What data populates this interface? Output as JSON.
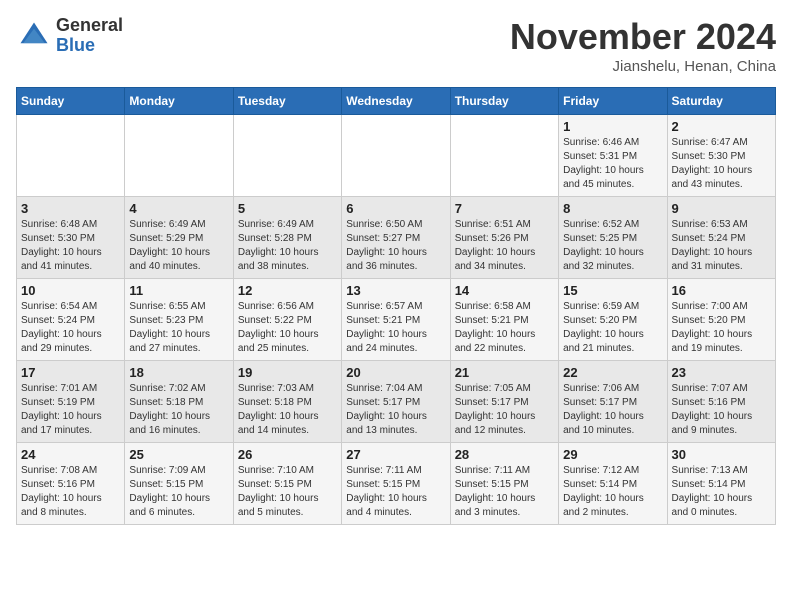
{
  "header": {
    "logo_general": "General",
    "logo_blue": "Blue",
    "month": "November 2024",
    "location": "Jianshelu, Henan, China"
  },
  "weekdays": [
    "Sunday",
    "Monday",
    "Tuesday",
    "Wednesday",
    "Thursday",
    "Friday",
    "Saturday"
  ],
  "weeks": [
    [
      {
        "day": "",
        "info": ""
      },
      {
        "day": "",
        "info": ""
      },
      {
        "day": "",
        "info": ""
      },
      {
        "day": "",
        "info": ""
      },
      {
        "day": "",
        "info": ""
      },
      {
        "day": "1",
        "info": "Sunrise: 6:46 AM\nSunset: 5:31 PM\nDaylight: 10 hours\nand 45 minutes."
      },
      {
        "day": "2",
        "info": "Sunrise: 6:47 AM\nSunset: 5:30 PM\nDaylight: 10 hours\nand 43 minutes."
      }
    ],
    [
      {
        "day": "3",
        "info": "Sunrise: 6:48 AM\nSunset: 5:30 PM\nDaylight: 10 hours\nand 41 minutes."
      },
      {
        "day": "4",
        "info": "Sunrise: 6:49 AM\nSunset: 5:29 PM\nDaylight: 10 hours\nand 40 minutes."
      },
      {
        "day": "5",
        "info": "Sunrise: 6:49 AM\nSunset: 5:28 PM\nDaylight: 10 hours\nand 38 minutes."
      },
      {
        "day": "6",
        "info": "Sunrise: 6:50 AM\nSunset: 5:27 PM\nDaylight: 10 hours\nand 36 minutes."
      },
      {
        "day": "7",
        "info": "Sunrise: 6:51 AM\nSunset: 5:26 PM\nDaylight: 10 hours\nand 34 minutes."
      },
      {
        "day": "8",
        "info": "Sunrise: 6:52 AM\nSunset: 5:25 PM\nDaylight: 10 hours\nand 32 minutes."
      },
      {
        "day": "9",
        "info": "Sunrise: 6:53 AM\nSunset: 5:24 PM\nDaylight: 10 hours\nand 31 minutes."
      }
    ],
    [
      {
        "day": "10",
        "info": "Sunrise: 6:54 AM\nSunset: 5:24 PM\nDaylight: 10 hours\nand 29 minutes."
      },
      {
        "day": "11",
        "info": "Sunrise: 6:55 AM\nSunset: 5:23 PM\nDaylight: 10 hours\nand 27 minutes."
      },
      {
        "day": "12",
        "info": "Sunrise: 6:56 AM\nSunset: 5:22 PM\nDaylight: 10 hours\nand 25 minutes."
      },
      {
        "day": "13",
        "info": "Sunrise: 6:57 AM\nSunset: 5:21 PM\nDaylight: 10 hours\nand 24 minutes."
      },
      {
        "day": "14",
        "info": "Sunrise: 6:58 AM\nSunset: 5:21 PM\nDaylight: 10 hours\nand 22 minutes."
      },
      {
        "day": "15",
        "info": "Sunrise: 6:59 AM\nSunset: 5:20 PM\nDaylight: 10 hours\nand 21 minutes."
      },
      {
        "day": "16",
        "info": "Sunrise: 7:00 AM\nSunset: 5:20 PM\nDaylight: 10 hours\nand 19 minutes."
      }
    ],
    [
      {
        "day": "17",
        "info": "Sunrise: 7:01 AM\nSunset: 5:19 PM\nDaylight: 10 hours\nand 17 minutes."
      },
      {
        "day": "18",
        "info": "Sunrise: 7:02 AM\nSunset: 5:18 PM\nDaylight: 10 hours\nand 16 minutes."
      },
      {
        "day": "19",
        "info": "Sunrise: 7:03 AM\nSunset: 5:18 PM\nDaylight: 10 hours\nand 14 minutes."
      },
      {
        "day": "20",
        "info": "Sunrise: 7:04 AM\nSunset: 5:17 PM\nDaylight: 10 hours\nand 13 minutes."
      },
      {
        "day": "21",
        "info": "Sunrise: 7:05 AM\nSunset: 5:17 PM\nDaylight: 10 hours\nand 12 minutes."
      },
      {
        "day": "22",
        "info": "Sunrise: 7:06 AM\nSunset: 5:17 PM\nDaylight: 10 hours\nand 10 minutes."
      },
      {
        "day": "23",
        "info": "Sunrise: 7:07 AM\nSunset: 5:16 PM\nDaylight: 10 hours\nand 9 minutes."
      }
    ],
    [
      {
        "day": "24",
        "info": "Sunrise: 7:08 AM\nSunset: 5:16 PM\nDaylight: 10 hours\nand 8 minutes."
      },
      {
        "day": "25",
        "info": "Sunrise: 7:09 AM\nSunset: 5:15 PM\nDaylight: 10 hours\nand 6 minutes."
      },
      {
        "day": "26",
        "info": "Sunrise: 7:10 AM\nSunset: 5:15 PM\nDaylight: 10 hours\nand 5 minutes."
      },
      {
        "day": "27",
        "info": "Sunrise: 7:11 AM\nSunset: 5:15 PM\nDaylight: 10 hours\nand 4 minutes."
      },
      {
        "day": "28",
        "info": "Sunrise: 7:11 AM\nSunset: 5:15 PM\nDaylight: 10 hours\nand 3 minutes."
      },
      {
        "day": "29",
        "info": "Sunrise: 7:12 AM\nSunset: 5:14 PM\nDaylight: 10 hours\nand 2 minutes."
      },
      {
        "day": "30",
        "info": "Sunrise: 7:13 AM\nSunset: 5:14 PM\nDaylight: 10 hours\nand 0 minutes."
      }
    ]
  ]
}
